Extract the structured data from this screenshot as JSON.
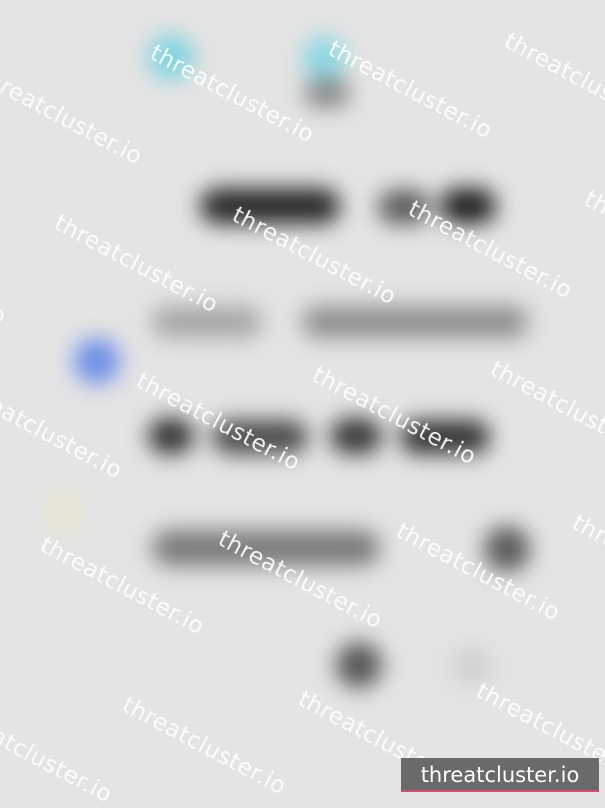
{
  "watermark": {
    "text": "threatcluster.io"
  },
  "brand_badge": {
    "text": "threatcluster.io"
  },
  "colors": {
    "background": "#e4e4e4",
    "accent_teal": "#7fd4e0",
    "accent_blue": "#6c8ee8",
    "badge": "#6a6a6a",
    "badge_underline": "#d94b6a"
  }
}
